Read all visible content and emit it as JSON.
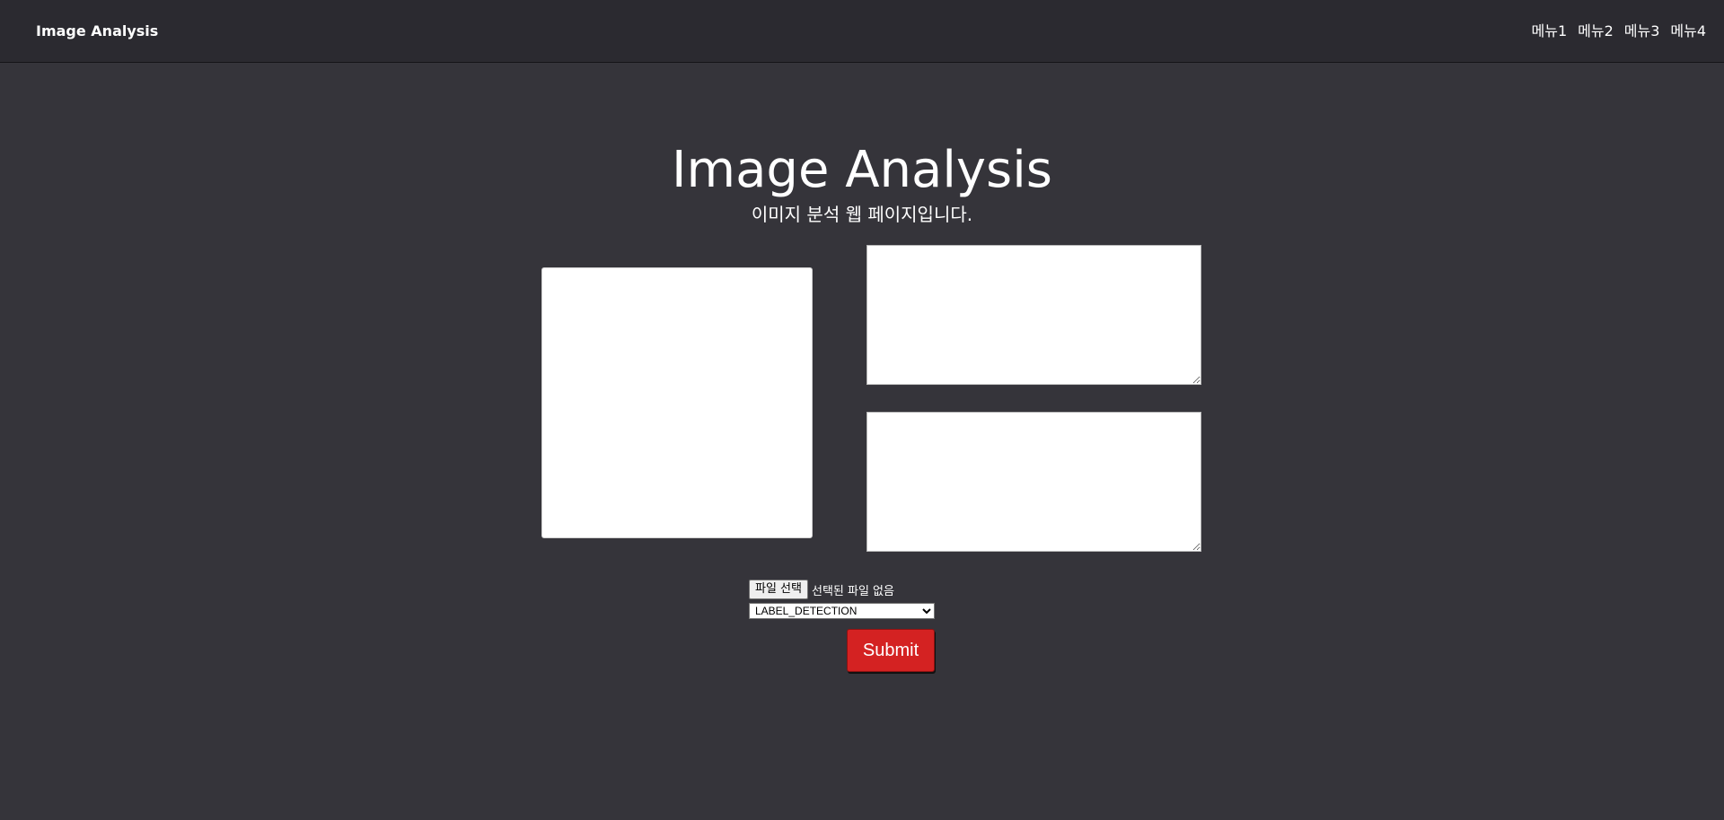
{
  "navbar": {
    "brand": "Image Analysis",
    "menu": [
      "메뉴1",
      "메뉴2",
      "메뉴3",
      "메뉴4"
    ]
  },
  "hero": {
    "title": "Image Analysis",
    "subtitle": "이미지 분석 웹 페이지입니다."
  },
  "form": {
    "file_button_label": "파일 선택",
    "file_status": "선택된 파일 없음",
    "analysis_type_selected": "LABEL_DETECTION",
    "submit_label": "Submit"
  },
  "colors": {
    "background": "#35343a",
    "navbar": "#2b2a30",
    "submit": "#d42222"
  }
}
